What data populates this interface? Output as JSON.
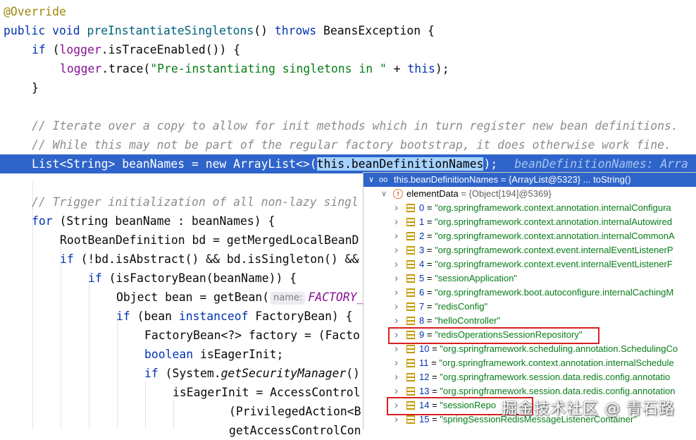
{
  "code": {
    "l1": {
      "ann": "@Override"
    },
    "l2": {
      "kw1": "public",
      "kw2": "void",
      "fn": "preInstantiateSingletons",
      "mid": "() ",
      "kw3": "throws",
      "rest": " BeansException {"
    },
    "l3": {
      "kw": "if",
      "a": " (",
      "fld": "logger",
      "b": ".isTraceEnabled()) {"
    },
    "l4": {
      "fld": "logger",
      "a": ".trace(",
      "str": "\"Pre-instantiating singletons in \"",
      "b": " + ",
      "kw": "this",
      "c": ");"
    },
    "l5": {
      "text": "}"
    },
    "l7": {
      "cmt": "// Iterate over a copy to allow for init methods which in turn register new bean definitions."
    },
    "l8": {
      "cmt": "// While this may not be part of the regular factory bootstrap, it does otherwise work fine."
    },
    "l9": {
      "a": "List<String> beanNames = new ArrayList<>(",
      "sel": "this.beanDefinitionNames",
      "b": ");",
      "hint": "beanDefinitionNames: Arra"
    },
    "l11": {
      "cmt": "// Trigger initialization of all non-lazy singl"
    },
    "l12": {
      "kw": "for",
      "rest": " (String beanName : beanNames) {"
    },
    "l13": {
      "text": "RootBeanDefinition bd = getMergedLocalBeanD"
    },
    "l14": {
      "kw": "if",
      "rest": " (!bd.isAbstract() && bd.isSingleton() &&"
    },
    "l15": {
      "kw": "if",
      "rest": " (isFactoryBean(beanName)) {"
    },
    "l16": {
      "a": "Object bean = getBean(",
      "inlay": "name:",
      "inlay_val": "FACTORY_"
    },
    "l17": {
      "kw": "if",
      "a": " (bean ",
      "kw2": "instanceof",
      "b": " FactoryBean) {"
    },
    "l18": {
      "text": "FactoryBean<?> factory = (Facto"
    },
    "l19": {
      "kw": "boolean",
      "rest": " isEagerInit;"
    },
    "l20": {
      "kw": "if",
      "a": " (System.",
      "ital": "getSecurityManager",
      "b": "()"
    },
    "l21": {
      "text": "isEagerInit = AccessControl"
    },
    "l22": {
      "text": "(PrivilegedAction<B"
    },
    "l23": {
      "text": "getAccessControlCon"
    }
  },
  "debugger": {
    "header": {
      "name": "this.beanDefinitionNames",
      "value": " = {ArrayList@5323} ... ",
      "link": "toString()"
    },
    "element_data": {
      "name": "elementData",
      "value": " = {Object[194]@5369}"
    },
    "items": [
      {
        "index": "0",
        "value": "\"org.springframework.context.annotation.internalConfigura"
      },
      {
        "index": "1",
        "value": "\"org.springframework.context.annotation.internalAutowired"
      },
      {
        "index": "2",
        "value": "\"org.springframework.context.annotation.internalCommonA"
      },
      {
        "index": "3",
        "value": "\"org.springframework.context.event.internalEventListenerP"
      },
      {
        "index": "4",
        "value": "\"org.springframework.context.event.internalEventListenerF"
      },
      {
        "index": "5",
        "value": "\"sessionApplication\""
      },
      {
        "index": "6",
        "value": "\"org.springframework.boot.autoconfigure.internalCachingM"
      },
      {
        "index": "7",
        "value": "\"redisConfig\""
      },
      {
        "index": "8",
        "value": "\"helloController\""
      },
      {
        "index": "9",
        "value": "\"redisOperationsSessionRepository\""
      },
      {
        "index": "10",
        "value": "\"org.springframework.scheduling.annotation.SchedulingCo"
      },
      {
        "index": "11",
        "value": "\"org.springframework.context.annotation.internalSchedule"
      },
      {
        "index": "12",
        "value": "\"org.springframework.session.data.redis.config.annotatio"
      },
      {
        "index": "13",
        "value": "\"org.springframework.session.data.redis.config.annotation"
      },
      {
        "index": "14",
        "value": "\"sessionRepo"
      },
      {
        "index": "15",
        "value": "\"springSessionRedisMessageListenerContainer\""
      }
    ],
    "eq": " = "
  },
  "watermark": "掘金技术社区 @ 青石路",
  "colors": {
    "keyword": "#0033b3",
    "string": "#067d17",
    "annotation": "#9e880d",
    "comment": "#8c8c8c",
    "selection_line": "#2f65ca",
    "highlight_box": "#d92020"
  }
}
